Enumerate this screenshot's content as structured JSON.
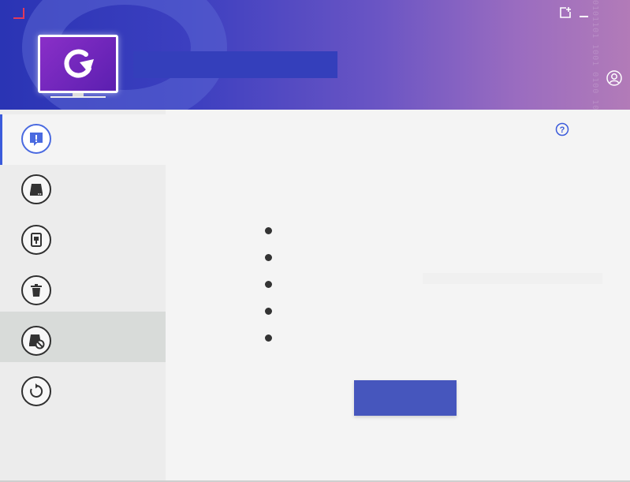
{
  "app": {
    "title": "",
    "header_digits": "0101101 1001 0100 1011 010 011 10010 1101 0011 1100 010110 01001 1011001 010 1010 01101 00101 1100 101 0110 10101 0010 11010 0101 1001 0110 101 0011 1101"
  },
  "window": {
    "feedback_icon": "add-note-icon",
    "minimize_icon": "minimize-icon",
    "account_icon": "user-icon"
  },
  "sidebar": {
    "items": [
      {
        "name": "alert",
        "icon": "alert-icon",
        "label": "",
        "state": "active"
      },
      {
        "name": "drive",
        "icon": "hard-drive-icon",
        "label": "",
        "state": "normal"
      },
      {
        "name": "device",
        "icon": "device-icon",
        "label": "",
        "state": "normal"
      },
      {
        "name": "trash",
        "icon": "trash-icon",
        "label": "",
        "state": "normal"
      },
      {
        "name": "blocked-drive",
        "icon": "drive-blocked-icon",
        "label": "",
        "state": "hover"
      },
      {
        "name": "restore",
        "icon": "refresh-icon",
        "label": "",
        "state": "normal"
      }
    ]
  },
  "main": {
    "help_icon": "help-icon",
    "description": "",
    "bullets": [
      "",
      "",
      "",
      "",
      ""
    ],
    "primary_button_label": ""
  },
  "colors": {
    "accent": "#4656bd",
    "active_indicator": "#3b5bdb",
    "hover_bg": "#d8dbd9",
    "sidebar_bg": "#ececec",
    "main_bg": "#f4f4f4"
  }
}
